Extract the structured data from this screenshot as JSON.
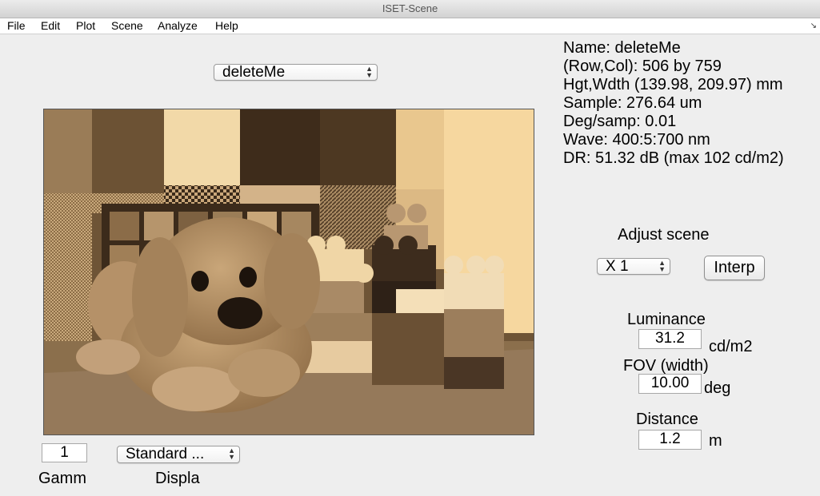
{
  "window": {
    "title": "ISET-Scene"
  },
  "menu": {
    "items": [
      "File",
      "Edit",
      "Plot",
      "Scene",
      "Analyze",
      "Help"
    ]
  },
  "scene_selector": {
    "value": "deleteMe"
  },
  "info": {
    "name": "Name: deleteMe",
    "rowcol": "(Row,Col): 506 by 759",
    "hgt_wdth": "Hgt,Wdth (139.98, 209.97) mm",
    "sample": "Sample: 276.64 um",
    "deg_samp": "Deg/samp: 0.01",
    "wave": "Wave: 400:5:700 nm",
    "dr": "DR: 51.32 dB (max 102 cd/m2)"
  },
  "adjust": {
    "label": "Adjust scene",
    "scale_value": "X 1",
    "interp_label": "Interp"
  },
  "luminance": {
    "label": "Luminance",
    "value": "31.2",
    "unit": "cd/m2"
  },
  "fov": {
    "label": "FOV (width)",
    "value": "10.00",
    "unit": "deg"
  },
  "distance": {
    "label": "Distance",
    "value": "1.2",
    "unit": "m"
  },
  "gamma": {
    "value": "1",
    "label": "Gamm"
  },
  "display": {
    "value": "Standard ...",
    "label": "Displa"
  },
  "colors": {
    "sepia_light": "#f3d29b",
    "sepia_mid": "#a88453",
    "sepia_dark": "#5a4026"
  }
}
